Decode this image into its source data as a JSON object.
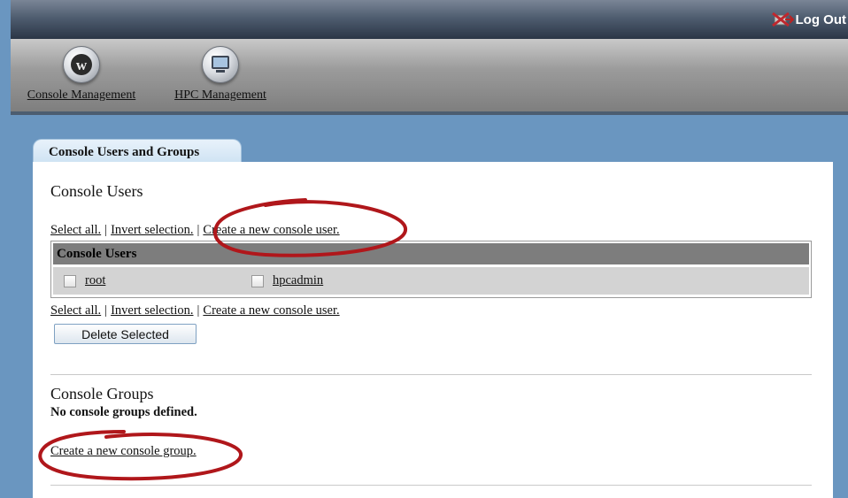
{
  "header": {
    "logout_label": "Log Out"
  },
  "nav": {
    "items": [
      {
        "label": "Console Management",
        "icon": "console-management-icon"
      },
      {
        "label": "HPC Management",
        "icon": "monitor-icon"
      }
    ]
  },
  "tab": {
    "label": "Console Users and Groups"
  },
  "users_section": {
    "title": "Console Users",
    "select_all": "Select all.",
    "invert_selection_top": "Invert selection.",
    "invert_selection": "Invert selection.",
    "create_user": "Create a new console user.",
    "table_header": "Console Users",
    "users": [
      "root",
      "hpcadmin"
    ],
    "delete_button": "Delete Selected"
  },
  "groups_section": {
    "title": "Console Groups",
    "empty_message": "No console groups defined.",
    "create_group": "Create a new console group."
  },
  "colors": {
    "annotation": "#b0171b",
    "background": "#6a96c0"
  }
}
